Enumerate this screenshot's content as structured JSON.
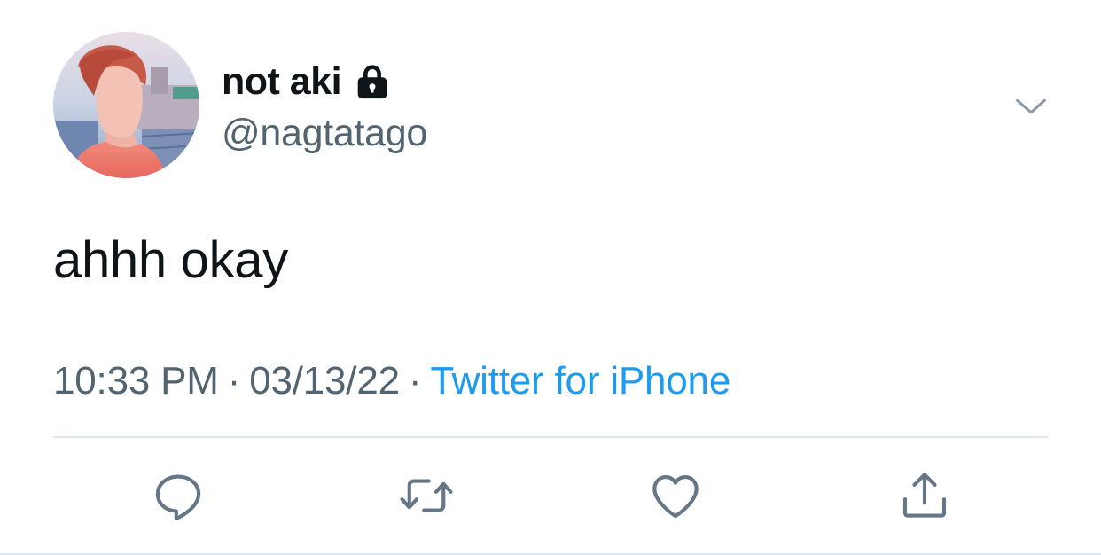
{
  "tweet": {
    "author": {
      "display_name": "not aki",
      "handle": "@nagtatago",
      "protected_icon": "lock-icon",
      "avatar_icon": "avatar-photo"
    },
    "text": "ahhh okay",
    "meta": {
      "time": "10:33 PM",
      "separator": "·",
      "date": "03/13/22",
      "source": "Twitter for iPhone"
    },
    "menu_icon": "chevron-down-icon",
    "actions": [
      {
        "name": "reply",
        "icon": "reply-icon"
      },
      {
        "name": "retweet",
        "icon": "retweet-icon"
      },
      {
        "name": "like",
        "icon": "heart-icon"
      },
      {
        "name": "share",
        "icon": "share-icon"
      }
    ]
  },
  "colors": {
    "primary_text": "#0f1419",
    "secondary_text": "#536471",
    "link": "#1d9bf0",
    "divider": "#e1e8ed"
  }
}
